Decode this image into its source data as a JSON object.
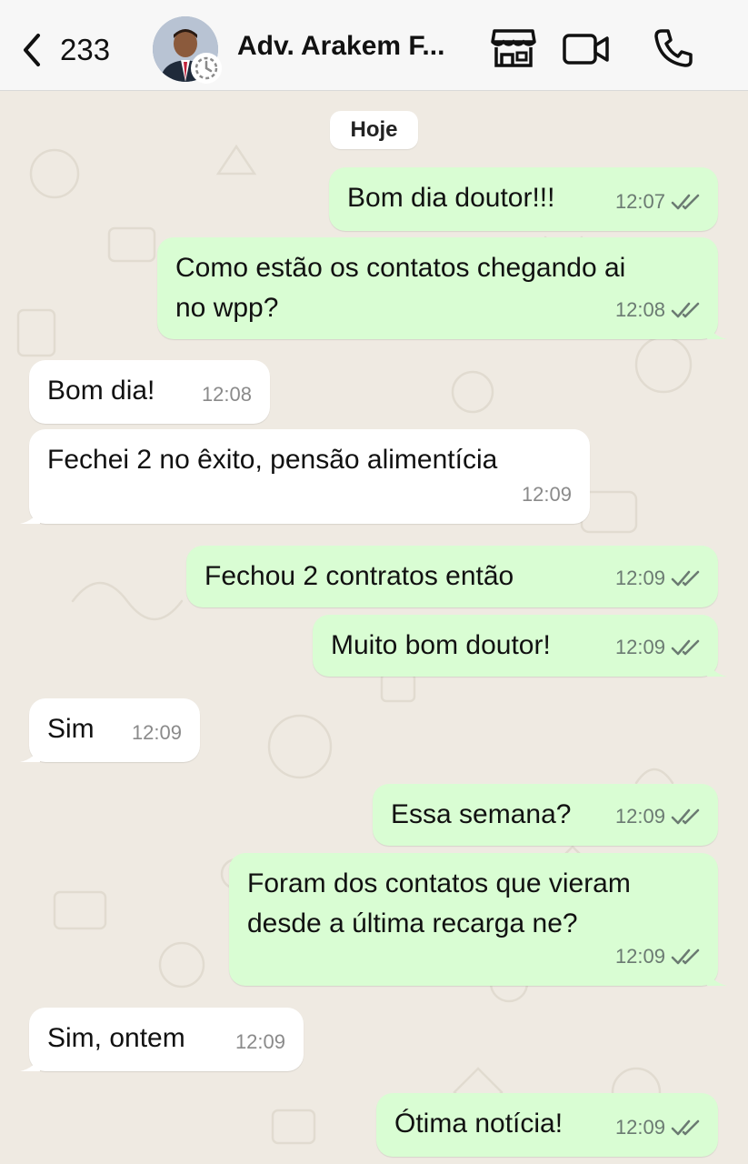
{
  "header": {
    "back_count": "233",
    "contact_name": "Adv. Arakem F...",
    "icons": [
      "chevron-left-icon",
      "storefront-icon",
      "video-camera-icon",
      "phone-icon"
    ]
  },
  "chat": {
    "date_label": "Hoje",
    "messages": [
      {
        "direction": "out",
        "text": "Bom dia doutor!!!",
        "time": "12:07",
        "status": "read"
      },
      {
        "direction": "out",
        "text": "Como estão os contatos chegando ai\nno wpp?",
        "time": "12:08",
        "status": "read"
      },
      {
        "direction": "in",
        "text": "Bom dia!",
        "time": "12:08"
      },
      {
        "direction": "in",
        "text": "Fechei 2 no êxito, pensão alimentícia",
        "time": "12:09"
      },
      {
        "direction": "out",
        "text": "Fechou 2 contratos então",
        "time": "12:09",
        "status": "read"
      },
      {
        "direction": "out",
        "text": "Muito bom doutor!",
        "time": "12:09",
        "status": "read"
      },
      {
        "direction": "in",
        "text": "Sim",
        "time": "12:09"
      },
      {
        "direction": "out",
        "text": "Essa semana?",
        "time": "12:09",
        "status": "read"
      },
      {
        "direction": "out",
        "text": "Foram dos contatos que vieram\ndesde a última recarga ne?",
        "time": "12:09",
        "status": "read"
      },
      {
        "direction": "in",
        "text": "Sim, ontem",
        "time": "12:09"
      },
      {
        "direction": "out",
        "text": "Ótima notícia!",
        "time": "12:09",
        "status": "read"
      }
    ]
  },
  "colors": {
    "outgoing_bubble": "#d9fdd3",
    "incoming_bubble": "#ffffff",
    "chat_background": "#efeae2",
    "read_ticks": "#6b7a72"
  }
}
